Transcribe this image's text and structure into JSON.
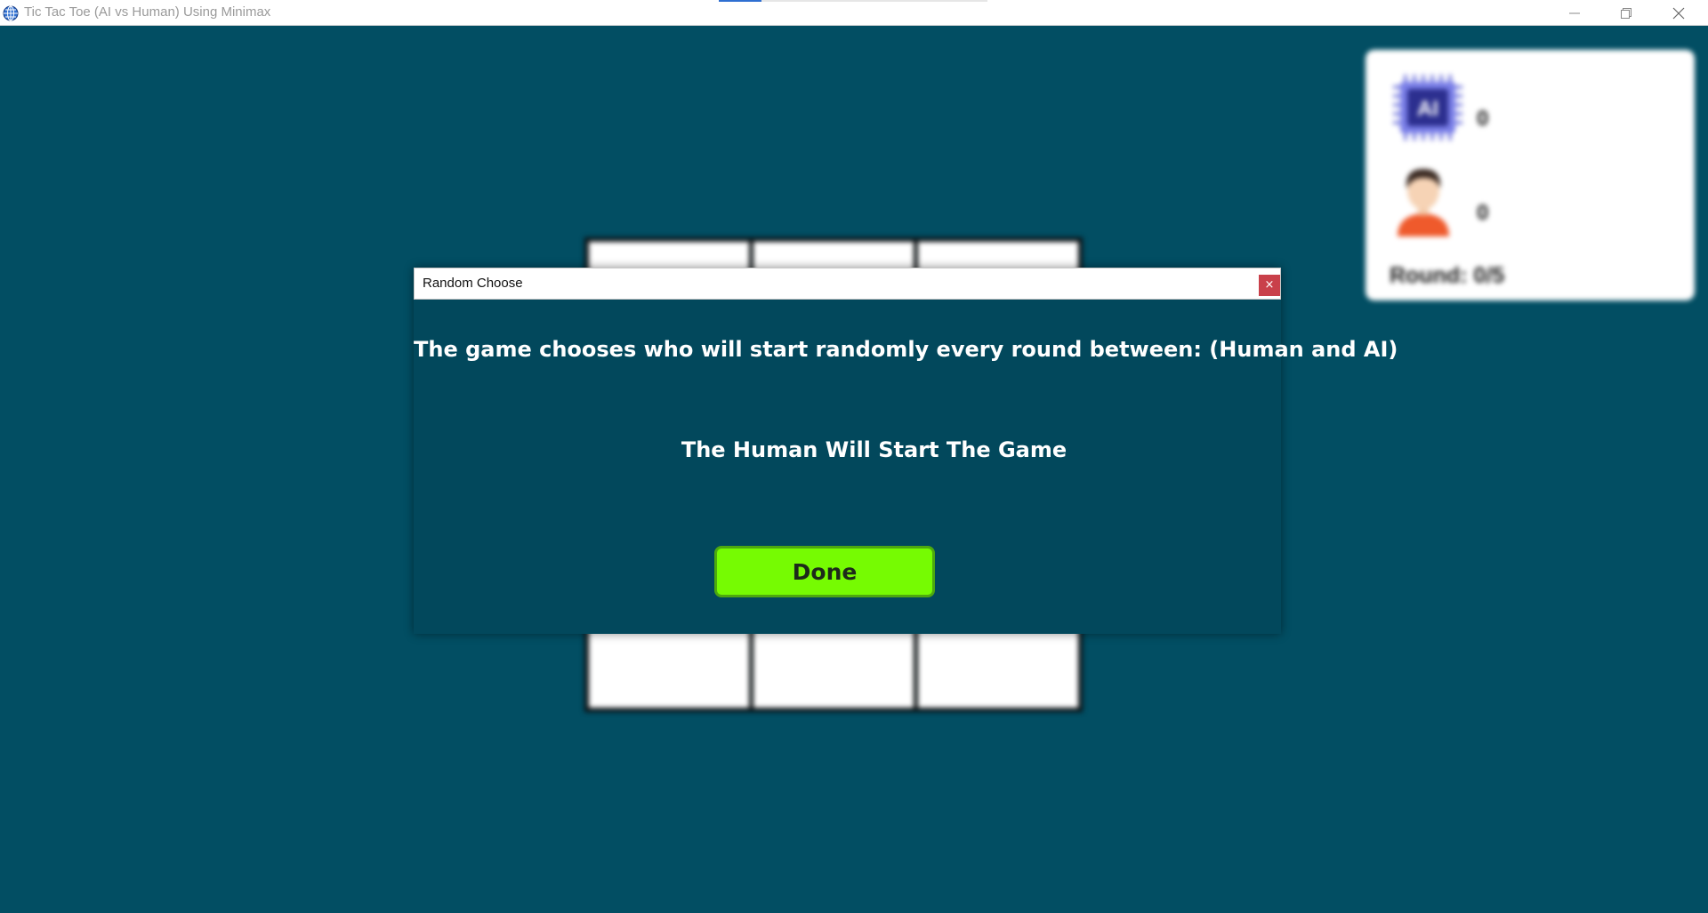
{
  "window": {
    "title": "Tic Tac Toe (AI vs Human) Using Minimax",
    "progress_fraction": 0.16
  },
  "scoreboard": {
    "ai_badge_text": "AI",
    "ai_score": "0",
    "human_score": "0",
    "round_label": "Round: 0/5",
    "ai_icon": "ai-chip-icon",
    "human_icon": "person-avatar-icon"
  },
  "board": {
    "cells": [
      "",
      "",
      "",
      "",
      "",
      "",
      "",
      "",
      ""
    ]
  },
  "dialog": {
    "title": "Random Choose",
    "close_label": "×",
    "message": "The game chooses who will start randomly every round between: (Human and AI)",
    "result": "The Human Will Start The Game",
    "done_label": "Done"
  },
  "colors": {
    "background": "#024e63",
    "dialog_body": "#02485c",
    "done_button": "#76fb02",
    "close_button": "#c9404a"
  }
}
